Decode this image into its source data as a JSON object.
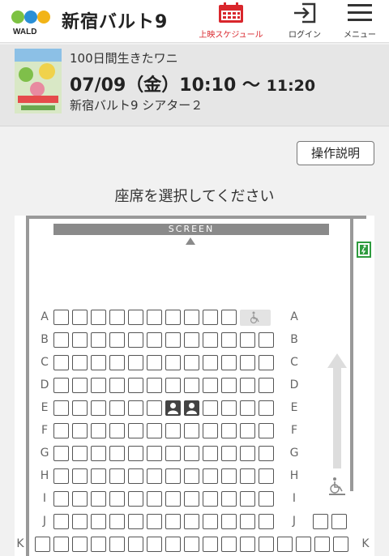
{
  "header": {
    "brand": "新宿バルト9",
    "logo_text": "WALD",
    "nav": [
      {
        "label": "上映スケジュール",
        "icon": "calendar-icon"
      },
      {
        "label": "ログイン",
        "icon": "login-icon"
      },
      {
        "label": "メニュー",
        "icon": "hamburger-menu-icon"
      }
    ],
    "accent_color": "#d9262c"
  },
  "movie": {
    "title": "100日間生きたワニ",
    "start": "07/09（金）10:10 〜",
    "end": "11:20",
    "venue": "新宿バルト9 シアター２"
  },
  "help_button": "操作説明",
  "instruction": "座席を選択してください",
  "screen_label": "SCREEN",
  "rows": [
    "A",
    "B",
    "C",
    "D",
    "E",
    "F",
    "G",
    "H",
    "I",
    "J",
    "K"
  ],
  "taken_seats": [
    {
      "row": "E",
      "seat": 7
    },
    {
      "row": "E",
      "seat": 8
    }
  ],
  "wheelchair_seats": [
    {
      "row": "A",
      "seat": 11
    }
  ]
}
